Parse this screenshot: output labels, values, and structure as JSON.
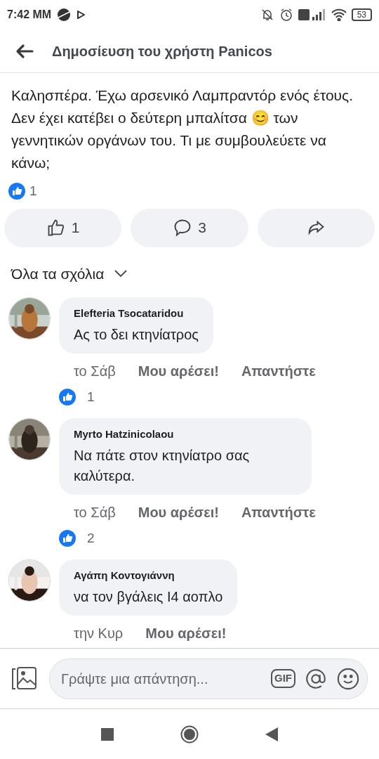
{
  "status_bar": {
    "time": "7:42 MM",
    "battery": "53"
  },
  "header": {
    "title": "Δημοσίευση του χρήστη Panicos"
  },
  "post": {
    "text": "Καλησπέρα. Έχω αρσενικό Λαμπραντόρ ενός έτους. Δεν έχει κατέβει ο δεύτερη μπαλίτσα 😊 των γεννητικών οργάνων του. Τι με συμβουλεύετε να κάνω;",
    "reactions": "1"
  },
  "actions": [
    {
      "kind": "like",
      "label": "1"
    },
    {
      "kind": "comment",
      "label": "3"
    },
    {
      "kind": "share"
    }
  ],
  "filter": {
    "label": "Όλα τα σχόλια"
  },
  "comments": [
    {
      "author": "Elefteria Tsocataridou",
      "text": "Ας το δει κτηνίατρος",
      "time": "το Σάβ",
      "like": "Μου αρέσει!",
      "reply": "Απαντήστε",
      "reactions": "1"
    },
    {
      "author": "Myrto Hatzinicolaou",
      "text": "Να πάτε στον κτηνίατρο σας καλύτερα.",
      "time": "το Σάβ",
      "like": "Μου αρέσει!",
      "reply": "Απαντήστε",
      "reactions": "2"
    },
    {
      "author": "Αγάπη Κοντογιάννη",
      "text": "να τον βγάλεις Ι4 αοπλο",
      "time": "την Κυρ",
      "like": "Μου αρέσει!"
    }
  ],
  "composer": {
    "placeholder": "Γράψτε μια απάντηση...",
    "gif": "GIF"
  }
}
